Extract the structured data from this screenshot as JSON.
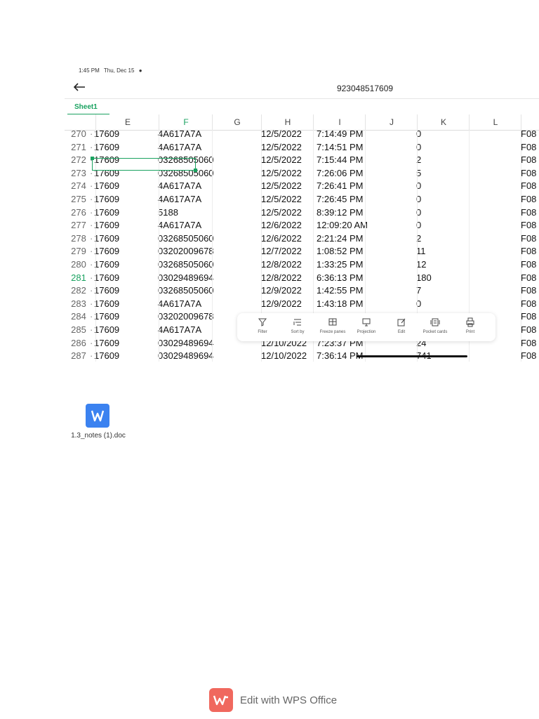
{
  "status_bar": {
    "time": "1:45 PM",
    "date": "Thu, Dec 15",
    "indicator": "●"
  },
  "title_bar": {
    "back_icon": "arrow-left-icon",
    "title": "923048517609"
  },
  "sheet": {
    "tab_label": "Sheet1"
  },
  "columns": [
    "E",
    "F",
    "G",
    "H",
    "I",
    "J",
    "K",
    "L"
  ],
  "active_column": "F",
  "rows": [
    {
      "num": "270",
      "e": "17609",
      "f": "4A617A7A",
      "h": "12/5/2022",
      "i": "7:14:49 PM",
      "k": "0",
      "m": "F08"
    },
    {
      "num": "271",
      "e": "17609",
      "f": "4A617A7A",
      "h": "12/5/2022",
      "i": "7:14:51 PM",
      "k": "0",
      "m": "F08"
    },
    {
      "num": "272",
      "e": "17609",
      "f": "03268505060",
      "h": "12/5/2022",
      "i": "7:15:44 PM",
      "k": "2",
      "m": "F08"
    },
    {
      "num": "273",
      "e": "17609",
      "f": "03268505060",
      "h": "12/5/2022",
      "i": "7:26:06 PM",
      "k": "5",
      "m": "F08"
    },
    {
      "num": "274",
      "e": "17609",
      "f": "4A617A7A",
      "h": "12/5/2022",
      "i": "7:26:41 PM",
      "k": "0",
      "m": "F08"
    },
    {
      "num": "275",
      "e": "17609",
      "f": "4A617A7A",
      "h": "12/5/2022",
      "i": "7:26:45 PM",
      "k": "0",
      "m": "F08"
    },
    {
      "num": "276",
      "e": "17609",
      "f": "5188",
      "h": "12/5/2022",
      "i": "8:39:12 PM",
      "k": "0",
      "m": "F08"
    },
    {
      "num": "277",
      "e": "17609",
      "f": "4A617A7A",
      "h": "12/6/2022",
      "i": "12:09:20 AM",
      "k": "0",
      "m": "F08"
    },
    {
      "num": "278",
      "e": "17609",
      "f": "03268505060",
      "h": "12/6/2022",
      "i": "2:21:24 PM",
      "k": "2",
      "m": "F08"
    },
    {
      "num": "279",
      "e": "17609",
      "f": "03202009678",
      "h": "12/7/2022",
      "i": "1:08:52 PM",
      "k": "11",
      "m": "F08"
    },
    {
      "num": "280",
      "e": "17609",
      "f": "03268505060",
      "h": "12/8/2022",
      "i": "1:33:25 PM",
      "k": "12",
      "m": "F08"
    },
    {
      "num": "281",
      "e": "17609",
      "f": "03029489694",
      "h": "12/8/2022",
      "i": "6:36:13 PM",
      "k": "180",
      "m": "F08"
    },
    {
      "num": "282",
      "e": "17609",
      "f": "03268505060",
      "h": "12/9/2022",
      "i": "1:42:55 PM",
      "k": "7",
      "m": "F08"
    },
    {
      "num": "283",
      "e": "17609",
      "f": "4A617A7A",
      "h": "12/9/2022",
      "i": "1:43:18 PM",
      "k": "0",
      "m": "F08"
    },
    {
      "num": "284",
      "e": "17609",
      "f": "03202009678",
      "h": "",
      "i": "",
      "k": "",
      "m": "F08"
    },
    {
      "num": "285",
      "e": "17609",
      "f": "4A617A7A",
      "h": "",
      "i": "",
      "k": "",
      "m": "F08"
    },
    {
      "num": "286",
      "e": "17609",
      "f": "03029489694",
      "h": "12/10/2022",
      "i": "7:23:37 PM",
      "k": "24",
      "m": "F08"
    },
    {
      "num": "287",
      "e": "17609",
      "f": "03029489694",
      "h": "12/10/2022",
      "i": "7:36:14 PM",
      "k": "741",
      "m": "F08"
    }
  ],
  "active_row": "281",
  "toolbar": [
    {
      "label": "Filter",
      "icon": "filter-icon"
    },
    {
      "label": "Sort by",
      "icon": "sort-icon"
    },
    {
      "label": "Freeze panes",
      "icon": "freeze-panes-icon"
    },
    {
      "label": "Projection",
      "icon": "projection-icon"
    },
    {
      "label": "Edit",
      "icon": "edit-icon"
    },
    {
      "label": "Pocket cards",
      "icon": "pocket-cards-icon"
    },
    {
      "label": "Print",
      "icon": "print-icon"
    }
  ],
  "file": {
    "name": "1.3_notes (1).doc",
    "icon": "wps-writer-icon",
    "icon_letter": "W"
  },
  "footer": {
    "text": "Edit with WPS Office",
    "logo": "wps-logo-icon"
  },
  "colors": {
    "accent": "#1aa260",
    "file_icon": "#3b82f0",
    "wps_red": "#f0685e"
  }
}
